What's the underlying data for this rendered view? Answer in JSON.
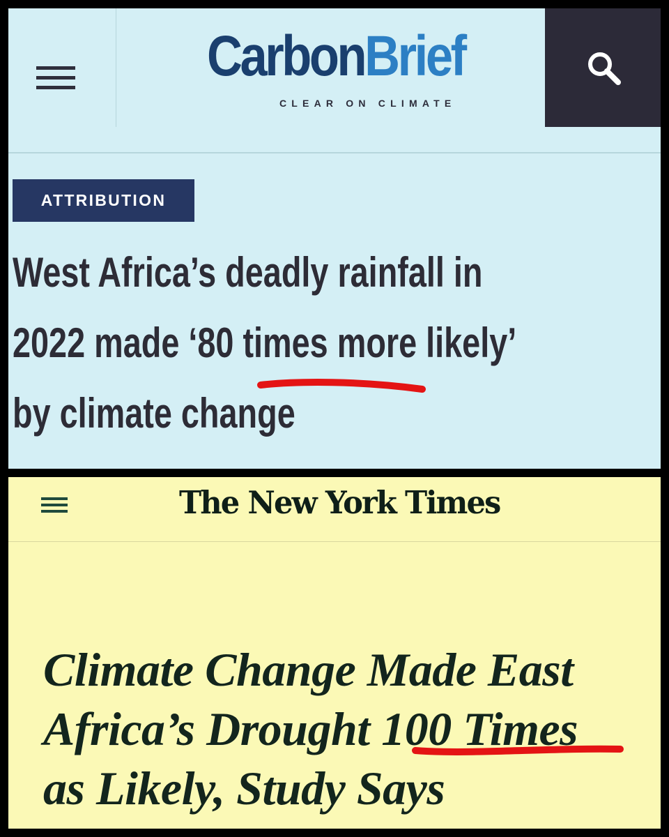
{
  "carbonbrief": {
    "logo": {
      "carbon": "Carbon",
      "brief": "Brief",
      "tagline": "CLEAR ON CLIMATE"
    },
    "menu_icon": "hamburger-icon",
    "search_icon": "magnifier-icon",
    "category_tag": "ATTRIBUTION",
    "headline": {
      "line1": "West Africa’s deadly rainfall in",
      "line2_before": "2022 made ‘",
      "line2_highlight": "80 times",
      "line2_after": " more likely’",
      "line3": "by climate change"
    },
    "colors": {
      "background": "#d4eff5",
      "logo_dark": "#1a3f6e",
      "logo_light": "#2c7fc4",
      "tag_bg": "#263763",
      "search_bg": "#2c2a38",
      "underline": "#e41414"
    }
  },
  "nyt": {
    "logo": "The New York Times",
    "menu_icon": "hamburger-icon",
    "headline": {
      "line1": "Climate Change Made East",
      "line2_before": "Africa’s Drought ",
      "line2_highlight": "100 Times",
      "line3": "as Likely, Study Says"
    },
    "colors": {
      "background": "#fbf9b6",
      "text": "#13251d",
      "underline": "#e41414"
    }
  }
}
